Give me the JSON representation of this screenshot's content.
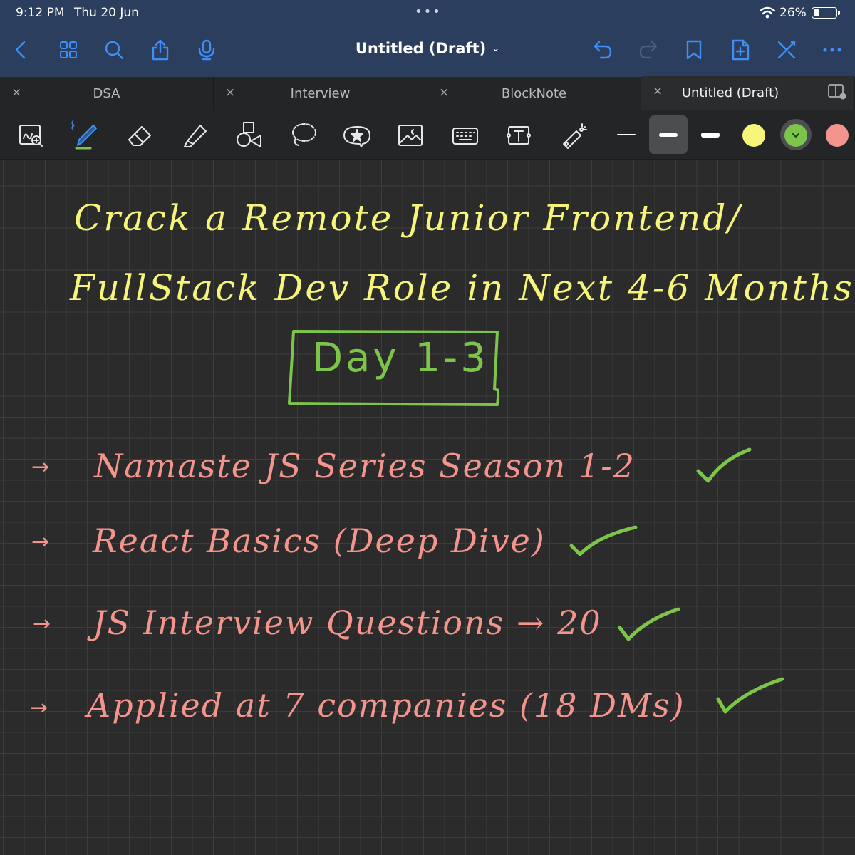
{
  "status": {
    "time": "9:12 PM",
    "date": "Thu 20 Jun",
    "battery_percent_text": "26%",
    "battery_level": 0.26,
    "more_dots": "•••"
  },
  "nav": {
    "title": "Untitled (Draft)",
    "title_chevron": "⌄",
    "accent_color": "#3d8ef5",
    "left_icons": [
      "back-icon",
      "grid-icon",
      "search-icon",
      "share-icon",
      "microphone-icon"
    ],
    "right_icons": [
      "undo-icon",
      "redo-icon",
      "bookmark-icon",
      "add-page-icon",
      "close-pen-icon",
      "more-icon"
    ]
  },
  "tabs": [
    {
      "label": "DSA",
      "active": false
    },
    {
      "label": "Interview",
      "active": false
    },
    {
      "label": "BlockNote",
      "active": false
    },
    {
      "label": "Untitled (Draft)",
      "active": true
    }
  ],
  "tab_close_glyph": "×",
  "tools": {
    "icons": [
      "zoom-window-icon",
      "pen-icon",
      "eraser-icon",
      "highlighter-icon",
      "shapes-icon",
      "lasso-icon",
      "sticker-icon",
      "image-icon",
      "keyboard-icon",
      "text-box-icon",
      "laser-pointer-icon"
    ],
    "selected_tool": "pen-icon",
    "line_widths": [
      "thin",
      "medium",
      "thick"
    ],
    "selected_line_width": "medium",
    "colors": [
      "#f6f57a",
      "#7cc54a",
      "#f3948d"
    ],
    "selected_color": "#7cc54a"
  },
  "note": {
    "title_line_1": "Crack a Remote Junior Frontend/",
    "title_line_2": "FullStack Dev Role in Next 4-6 Months",
    "day_label": "Day 1-3",
    "arrow_glyph": "→",
    "items": [
      "Namaste JS Series Season 1-2",
      "React Basics (Deep Dive)",
      "JS Interview Questions → 20",
      "Applied at 7 companies (18 DMs)"
    ],
    "items_completed": [
      true,
      true,
      true,
      true
    ],
    "title_color": "#f6f57a",
    "item_color": "#f3948d",
    "check_color": "#7cc54a"
  }
}
